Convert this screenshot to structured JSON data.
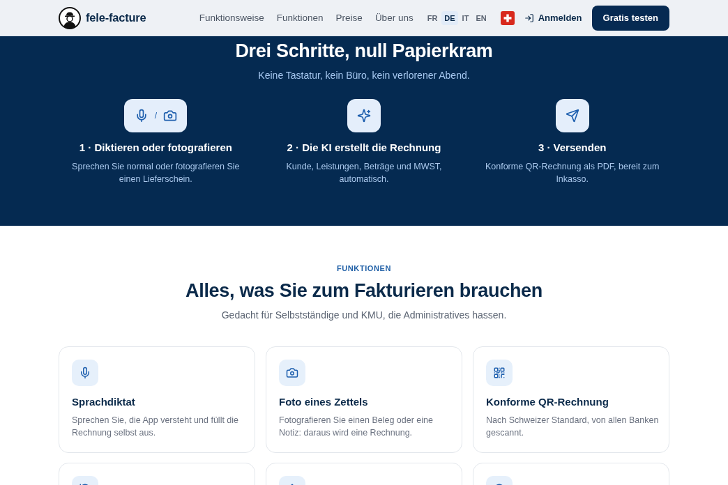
{
  "header": {
    "brand": "fele-facture",
    "nav": [
      "Funktionsweise",
      "Funktionen",
      "Preise",
      "Über uns"
    ],
    "languages": [
      {
        "label": "FR",
        "selected": false
      },
      {
        "label": "DE",
        "selected": true
      },
      {
        "label": "IT",
        "selected": false
      },
      {
        "label": "EN",
        "selected": false
      }
    ],
    "login": "Anmelden",
    "cta": "Gratis testen"
  },
  "how_it_works": {
    "title": "Drei Schritte, null Papierkram",
    "subtitle": "Keine Tastatur, kein Büro, kein verlorener Abend.",
    "steps": [
      {
        "kind": "dictate",
        "icon_separator": "/",
        "title": "1 · Diktieren oder fotografieren",
        "text": "Sprechen Sie normal oder fotografieren Sie einen Lieferschein."
      },
      {
        "kind": "generate",
        "title": "2 · Die KI erstellt die Rechnung",
        "text": "Kunde, Leistungen, Beträge und MWST, automatisch."
      },
      {
        "kind": "send",
        "title": "3 · Versenden",
        "text": "Konforme QR-Rechnung als PDF, bereit zum Inkasso."
      }
    ]
  },
  "features": {
    "eyebrow": "FUNKTIONEN",
    "title": "Alles, was Sie zum Fakturieren brauchen",
    "subtitle": "Gedacht für Selbstständige und KMU, die Administratives hassen.",
    "cards": [
      {
        "kind": "voice",
        "title": "Sprachdiktat",
        "text": "Sprechen Sie, die App versteht und füllt die Rechnung selbst aus."
      },
      {
        "kind": "photo",
        "title": "Foto eines Zettels",
        "text": "Fotografieren Sie einen Beleg oder eine Notiz: daraus wird eine Rechnung."
      },
      {
        "kind": "qr",
        "title": "Konforme QR-Rechnung",
        "text": "Nach Schweizer Standard, von allen Banken gescannt."
      },
      {
        "kind": "sync"
      },
      {
        "kind": "upload"
      },
      {
        "kind": "clock"
      }
    ]
  }
}
